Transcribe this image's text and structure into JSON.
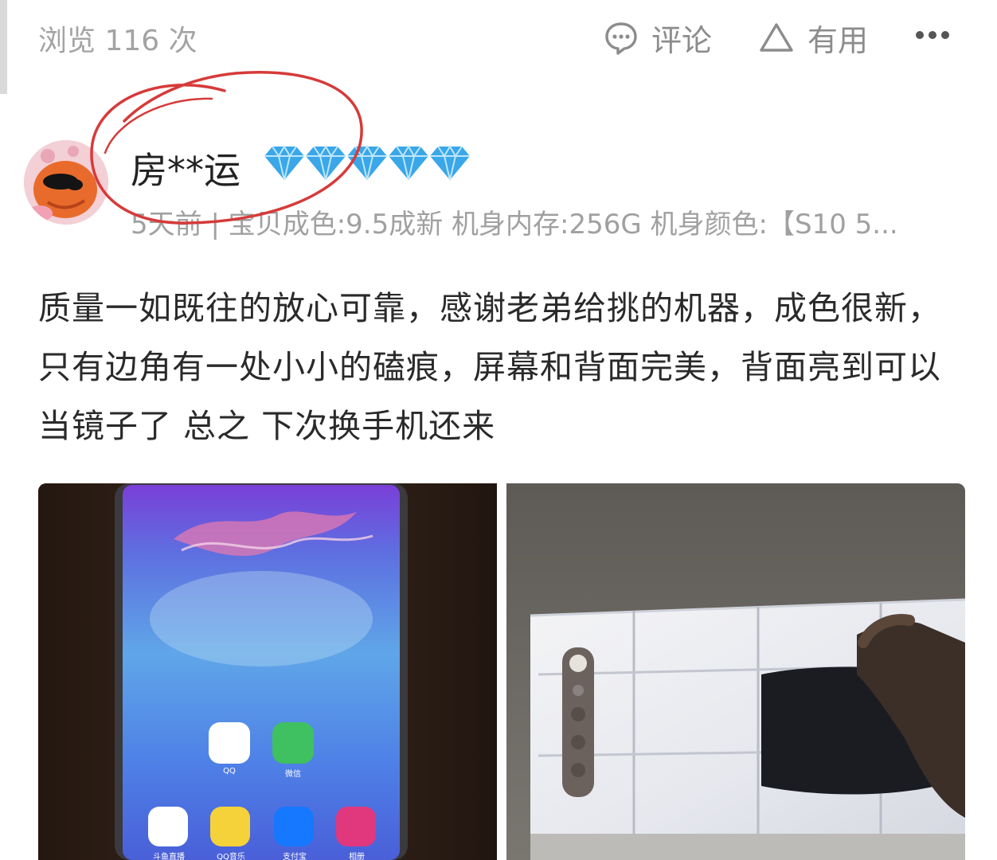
{
  "header": {
    "views": "浏览 116 次",
    "comment_label": "评论",
    "useful_label": "有用",
    "more_icon": "more-dots-icon"
  },
  "review": {
    "username": "房**运",
    "badge_count": 5,
    "badge_icon": "diamond-icon",
    "meta": "5天前 | 宝贝成色:9.5成新 机身内存:256G 机身颜色:【S10 5...",
    "text": "质量一如既往的放心可靠，感谢老弟给挑的机器，成色很新，只有边角有一处小小的磕痕，屏幕和背面完美，背面亮到可以当镜子了 总之 下次换手机还来"
  },
  "photos": {
    "front": {
      "app_labels": [
        "QQ",
        "微信",
        "斗鱼直播",
        "QQ音乐",
        "支付宝",
        "相册"
      ]
    }
  },
  "colors": {
    "annotation_circle": "#d63a3a",
    "diamond": "#3aa7e8",
    "meta_text": "#a0a0a0"
  }
}
